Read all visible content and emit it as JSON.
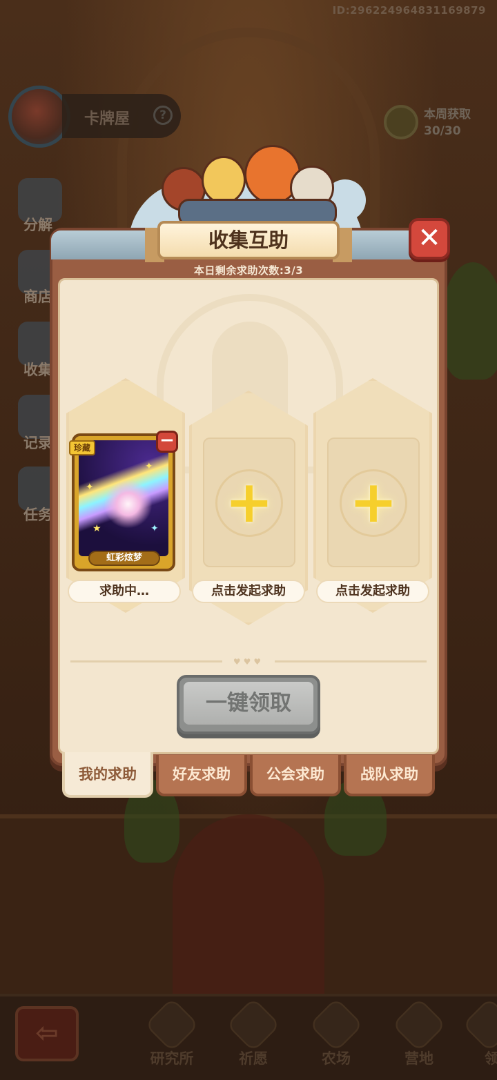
{
  "header": {
    "user_id": "ID:2962249648311698​79",
    "screen_title": "卡牌屋",
    "help_label": "?",
    "weekly_label": "本周获取",
    "weekly_count": "30/30"
  },
  "side_menu": [
    "分解",
    "商店",
    "收集",
    "记录",
    "任务"
  ],
  "modal": {
    "title": "收集互助",
    "close_label": "✕",
    "remaining_text": "本日剩余求助次数:3/3",
    "slots": [
      {
        "status": "求助中…",
        "card_name": "虹彩炫梦",
        "rarity": "珍藏",
        "remove_label": "−"
      },
      {
        "status": "点击发起求助",
        "plus": "+"
      },
      {
        "status": "点击发起求助",
        "plus": "+"
      }
    ],
    "claim_all_label": "一键领取",
    "tabs": [
      {
        "label": "我的求助",
        "active": true
      },
      {
        "label": "好友求助",
        "active": false
      },
      {
        "label": "公会求助",
        "active": false
      },
      {
        "label": "战队求助",
        "active": false
      }
    ]
  },
  "bottom_nav": {
    "back_label": "⇦",
    "items": [
      "研究所",
      "祈愿",
      "农场",
      "营地",
      "领"
    ]
  },
  "colors": {
    "modal_frame": "#9a5e43",
    "panel": "#f3e6cf",
    "close_red": "#d4483c",
    "plus_yellow": "#f6cf2c",
    "disabled_button": "#afb0ae"
  }
}
